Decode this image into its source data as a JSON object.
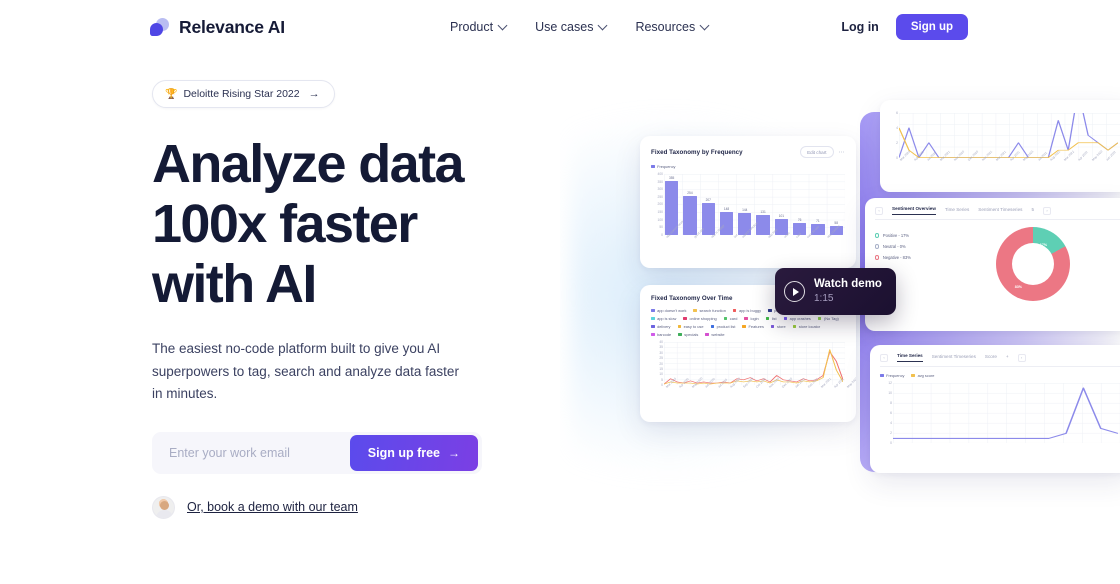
{
  "nav": {
    "brand": "Relevance AI",
    "links": [
      {
        "label": "Product",
        "icon": "chevron-down-icon"
      },
      {
        "label": "Use cases",
        "icon": "chevron-down-icon"
      },
      {
        "label": "Resources",
        "icon": "chevron-down-icon"
      }
    ],
    "login_label": "Log in",
    "signup_label": "Sign up",
    "accent": "#5b4bec"
  },
  "hero": {
    "badge": {
      "emoji": "🏆",
      "text": "Deloitte Rising Star 2022",
      "arrow": "→"
    },
    "headline_lines": [
      "Analyze data",
      "100x faster",
      "with AI"
    ],
    "subtitle": "The easiest no-code platform built to give you AI superpowers to tag, search and analyze data faster in minutes.",
    "email_placeholder": "Enter your work email",
    "email_value": "",
    "cta_label": "Sign up free",
    "cta_arrow": "→",
    "demo_link": "Or, book a demo with our team"
  },
  "watch_demo": {
    "title": "Watch demo",
    "duration": "1:15",
    "icon": "play-icon"
  },
  "cards": {
    "bar": {
      "title": "Fixed Taxonomy by Frequency",
      "edit_label": "Edit chart",
      "menu": "⋯",
      "legend": [
        "Frequency"
      ]
    },
    "line": {
      "title": "Fixed Taxonomy Over Time"
    },
    "donut": {
      "tabs": [
        "Sentiment Overview",
        "Time Series",
        "Sentiment Timeseries"
      ],
      "active_tab": "Sentiment Overview",
      "prev": "‹",
      "next": "›",
      "overflow": "5"
    },
    "timeseries": {
      "tabs": [
        "Time Series",
        "Sentiment Timeseries",
        "Score"
      ],
      "active_tab": "Time Series",
      "prev": "‹",
      "next": "›",
      "add": "+",
      "legend": [
        "Frequency",
        "avg score"
      ]
    }
  },
  "chart_data": [
    {
      "type": "bar",
      "title": "Fixed Taxonomy by Frequency",
      "xlabel": "",
      "ylabel": "",
      "ylim": [
        0,
        400
      ],
      "yticks": [
        0,
        50,
        100,
        150,
        200,
        250,
        300,
        350,
        400
      ],
      "grid": true,
      "legend": [
        "Frequency"
      ],
      "series_color": "#8c8aea",
      "categories": [
        "app doesn't work",
        "good app",
        "app is buggy",
        "list",
        "search function",
        "app load",
        "order",
        "card",
        "easy to use",
        "app crashes"
      ],
      "values": [
        355,
        254,
        207,
        148,
        144,
        131,
        101,
        76,
        71,
        58
      ]
    },
    {
      "type": "line",
      "title": "Fixed Taxonomy Over Time",
      "ylim": [
        0,
        40
      ],
      "yticks": [
        0,
        5,
        10,
        15,
        20,
        25,
        30,
        35,
        40
      ],
      "grid": true,
      "legend": [
        "app doesn't work",
        "search function",
        "app is buggy",
        "products",
        "good app",
        "app is slow",
        "online shopping",
        "card",
        "login",
        "list",
        "app crashes",
        "(No Tag)",
        "delivery",
        "easy to use",
        "product list",
        "Features",
        "store",
        "store locator",
        "barcode",
        "specials",
        "website"
      ],
      "legend_colors": [
        "#7b7ae8",
        "#f2c14e",
        "#ef5b5b",
        "#2f3b8c",
        "#2fa36f",
        "#5bd4dd",
        "#e03c6e",
        "#54c26a",
        "#e34fa0",
        "#3fb845",
        "#7a5cf0",
        "#8fd44a",
        "#6c63e0",
        "#f0b73a",
        "#3d6fe0",
        "#f5a623",
        "#7b5bdb",
        "#9bcd3c",
        "#d05be8",
        "#3fae5a",
        "#d54fd0"
      ],
      "x": [
        "Mar 2020",
        "Apr 2020",
        "May 2020",
        "Jun 2020",
        "Jul 2020",
        "Aug 2020",
        "Sep 2020",
        "Oct 2020",
        "Nov 2020",
        "Dec 2020",
        "Jan 2021",
        "Feb 2021",
        "Mar 2021",
        "Apr 2021",
        "May 2021",
        "Jun 2021",
        "Jul 2021",
        "Aug 2021",
        "Sep 2021",
        "Oct 2021",
        "Nov 2021",
        "Dec 2021",
        "Jan 2022",
        "Feb 2022",
        "Mar 2022",
        "Apr 2022",
        "May 2022",
        "Jun 2022"
      ],
      "series": [
        {
          "name": "app doesn't work",
          "color": "#ef7070",
          "values": [
            1,
            6,
            3,
            2,
            4,
            2,
            3,
            2,
            2,
            3,
            2,
            6,
            5,
            7,
            4,
            6,
            3,
            9,
            5,
            4,
            3,
            6,
            4,
            5,
            9,
            31,
            22,
            5
          ]
        },
        {
          "name": "search function",
          "color": "#f2c14e",
          "values": [
            1,
            3,
            2,
            2,
            2,
            1,
            2,
            1,
            2,
            2,
            2,
            4,
            3,
            4,
            3,
            4,
            2,
            5,
            3,
            3,
            2,
            4,
            3,
            4,
            7,
            33,
            14,
            3
          ]
        }
      ]
    },
    {
      "type": "pie",
      "title": "Sentiment Overview",
      "labels": [
        "Positive",
        "Neutral",
        "Negative"
      ],
      "values": [
        17,
        0,
        83
      ],
      "value_labels": [
        "17%",
        "0%",
        "83%"
      ],
      "colors": [
        "#5ecfb4",
        "#a8b0c8",
        "#ec7784"
      ],
      "legend": [
        "Positive - 17%",
        "Neutral - 0%",
        "Negative - 83%"
      ],
      "legend_position": "left"
    },
    {
      "type": "line",
      "title": "Time Series (top sparkline)",
      "ylim": [
        0,
        6
      ],
      "grid": true,
      "series": [
        {
          "name": "Frequency",
          "color": "#8c8aea",
          "values": [
            0,
            4,
            0,
            2,
            0,
            0,
            0,
            0,
            0,
            0,
            0,
            0,
            2,
            0,
            0,
            0,
            5,
            1,
            9,
            3,
            2,
            1,
            2
          ]
        },
        {
          "name": "avg score",
          "color": "#f2c14e",
          "values": [
            4,
            1,
            0,
            0,
            0,
            0,
            0,
            0,
            0,
            0,
            0,
            0,
            0,
            0,
            0,
            0,
            1,
            1,
            2,
            2,
            2,
            1,
            2
          ]
        }
      ]
    },
    {
      "type": "line",
      "title": "Time Series",
      "ylim": [
        0,
        12
      ],
      "yticks": [
        0,
        2,
        4,
        6,
        8,
        10,
        12
      ],
      "grid": true,
      "legend": [
        "Frequency",
        "avg score"
      ],
      "legend_colors": [
        "#7b7ae8",
        "#f2c14e"
      ],
      "series": [
        {
          "name": "Frequency",
          "color": "#8c8aea",
          "values": [
            1,
            1,
            1,
            1,
            1,
            1,
            1,
            1,
            1,
            1,
            2,
            11,
            3,
            2
          ]
        }
      ]
    }
  ]
}
